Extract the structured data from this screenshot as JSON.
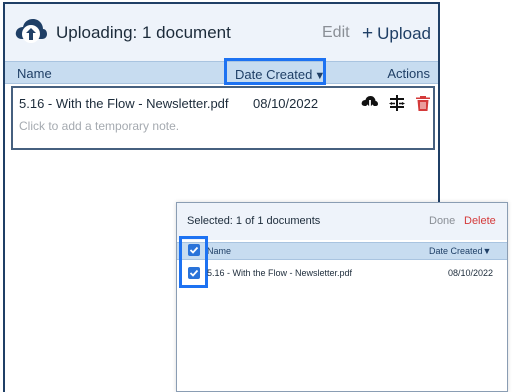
{
  "main": {
    "title": "Uploading: 1 document",
    "edit_label": "Edit",
    "upload_label": "Upload",
    "columns": {
      "name": "Name",
      "date_created": "Date Created",
      "actions": "Actions"
    },
    "document": {
      "name": "5.16 - With the Flow - Newsletter.pdf",
      "date": "08/10/2022",
      "note_placeholder": "Click to add a temporary note."
    }
  },
  "popup": {
    "title": "Selected: 1 of 1 documents",
    "done_label": "Done",
    "delete_label": "Delete",
    "columns": {
      "name": "Name",
      "date_created": "Date Created"
    },
    "row": {
      "name": "5.16 - With the Flow - Newsletter.pdf",
      "date": "08/10/2022",
      "checked": true
    },
    "select_all_checked": true
  },
  "colors": {
    "brand_dark": "#1f3f66",
    "header_bg": "#c7dcf0",
    "highlight": "#1d72f2",
    "delete_red": "#d43a3a"
  },
  "icons": [
    "cloud-upload-icon",
    "plus-icon",
    "sort-down-icon",
    "cloud-download-icon",
    "split-icon",
    "trash-icon",
    "checkmark-icon"
  ]
}
